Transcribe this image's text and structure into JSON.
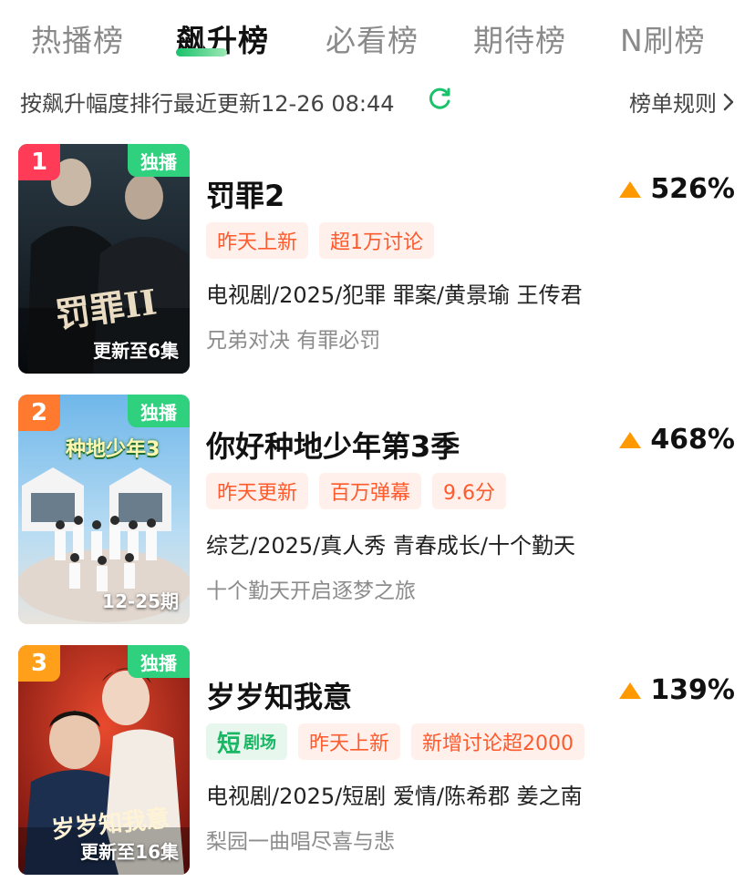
{
  "tabs": [
    {
      "label": "热播榜"
    },
    {
      "label": "飙升榜"
    },
    {
      "label": "必看榜"
    },
    {
      "label": "期待榜"
    },
    {
      "label": "N刷榜"
    }
  ],
  "active_tab": "飙升榜",
  "subheader": {
    "sort_text": "按飙升幅度排行最近更新12-26 08:44",
    "rules_label": "榜单规则"
  },
  "colors": {
    "accent_green": "#19c26b",
    "tag_orange": "#ff5a2c",
    "rise_arrow": "#ff9900",
    "rank1": "#ff3b58",
    "rank2": "#ff7a2f",
    "rank3": "#ff9f1a"
  },
  "items": [
    {
      "rank": "1",
      "badge": "独播",
      "poster_episodes": "更新至6集",
      "poster_logo": "罚罪II",
      "title": "罚罪2",
      "rise": "526%",
      "tags": [
        "昨天上新",
        "超1万讨论"
      ],
      "meta": "电视剧/2025/犯罪 罪案/黄景瑜 王传君",
      "desc": "兄弟对决 有罪必罚"
    },
    {
      "rank": "2",
      "badge": "独播",
      "poster_episodes": "12-25期",
      "poster_logo": "种地少年3",
      "title": "你好种地少年第3季",
      "rise": "468%",
      "tags": [
        "昨天更新",
        "百万弹幕",
        "9.6分"
      ],
      "meta": "综艺/2025/真人秀 青春成长/十个勤天",
      "desc": "十个勤天开启逐梦之旅"
    },
    {
      "rank": "3",
      "badge": "独播",
      "poster_episodes": "更新至16集",
      "poster_logo": "岁岁知我意",
      "title": "岁岁知我意",
      "rise": "139%",
      "short_tag": {
        "big": "短",
        "small": "剧场"
      },
      "tags": [
        "昨天上新",
        "新增讨论超2000"
      ],
      "meta": "电视剧/2025/短剧 爱情/陈希郡 姜之南",
      "desc": "梨园一曲唱尽喜与悲"
    }
  ]
}
